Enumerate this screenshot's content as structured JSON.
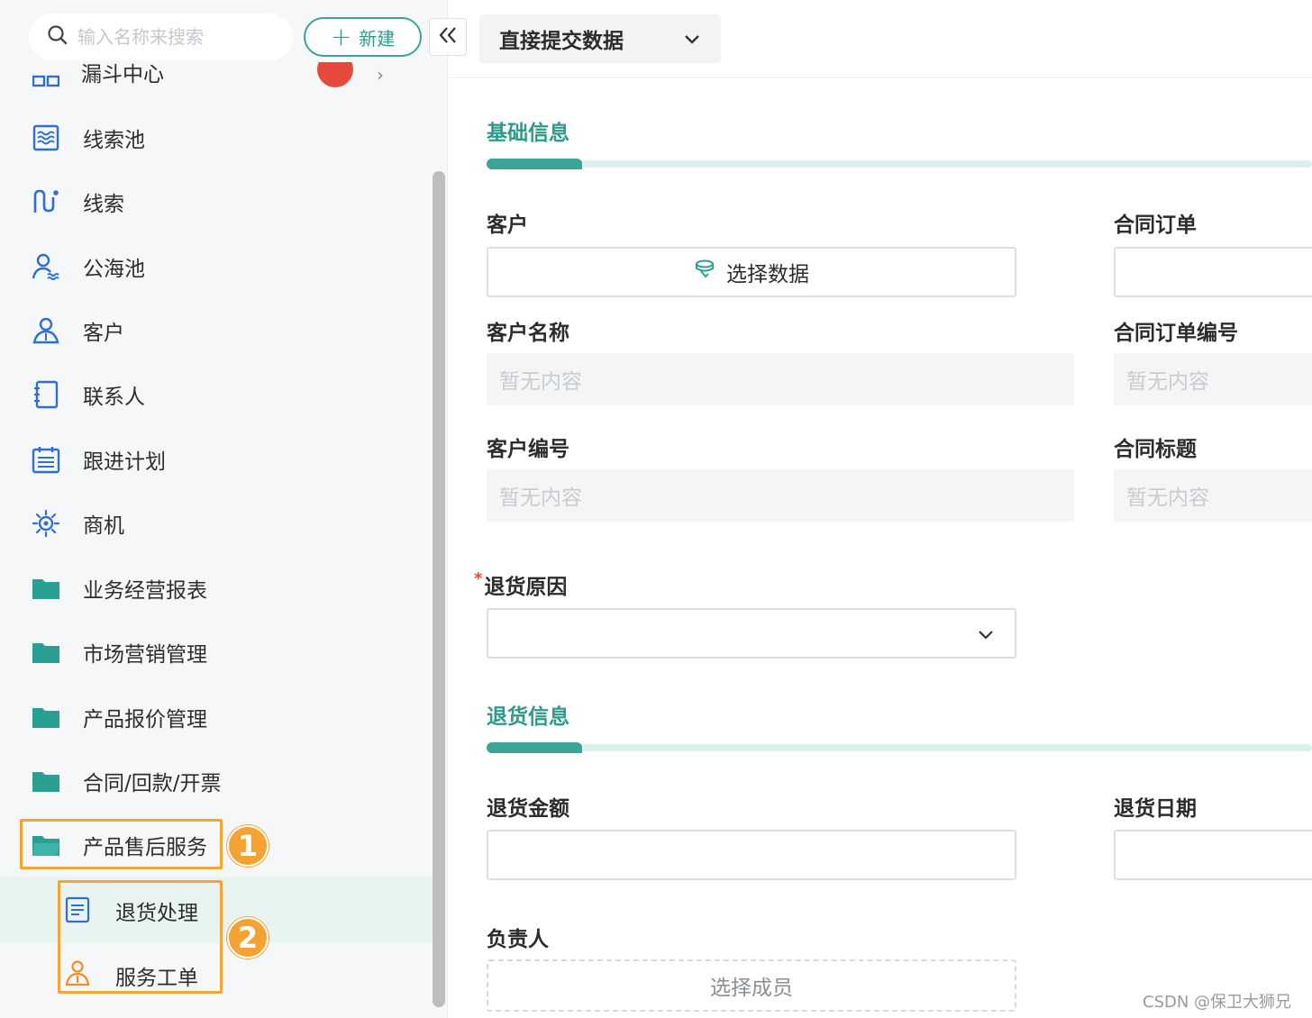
{
  "search": {
    "placeholder": "输入名称来搜索"
  },
  "new_button": {
    "label": "新建"
  },
  "sidebar": {
    "partial_label": "漏斗中心",
    "items": [
      {
        "label": "线索池",
        "icon": "lead-pool-icon"
      },
      {
        "label": "线索",
        "icon": "lead-icon"
      },
      {
        "label": "公海池",
        "icon": "public-pool-icon"
      },
      {
        "label": "客户",
        "icon": "customer-icon"
      },
      {
        "label": "联系人",
        "icon": "contact-icon"
      },
      {
        "label": "跟进计划",
        "icon": "plan-icon"
      },
      {
        "label": "商机",
        "icon": "opportunity-icon"
      },
      {
        "label": "业务经营报表",
        "icon": "folder-icon"
      },
      {
        "label": "市场营销管理",
        "icon": "folder-icon"
      },
      {
        "label": "产品报价管理",
        "icon": "folder-icon"
      },
      {
        "label": "合同/回款/开票",
        "icon": "folder-icon"
      },
      {
        "label": "产品售后服务",
        "icon": "folder-open-icon"
      }
    ],
    "sub_items": [
      {
        "label": "退货处理",
        "icon": "document-icon"
      },
      {
        "label": "服务工单",
        "icon": "person-icon"
      }
    ],
    "annotations": [
      "1",
      "2"
    ]
  },
  "header": {
    "mode_label": "直接提交数据"
  },
  "form": {
    "section_basic": "基础信息",
    "customer_label": "客户",
    "select_data_label": "选择数据",
    "contract_order_label": "合同订单",
    "customer_name_label": "客户名称",
    "contract_order_no_label": "合同订单编号",
    "customer_no_label": "客户编号",
    "contract_title_label": "合同标题",
    "empty_text": "暂无内容",
    "return_reason_label": "退货原因",
    "required_mark": "*",
    "section_return": "退货信息",
    "return_amount_label": "退货金额",
    "return_date_label": "退货日期",
    "owner_label": "负责人",
    "select_member_label": "选择成员"
  },
  "watermark": "CSDN @保卫大狮兄",
  "colors": {
    "accent": "#3aa596",
    "highlight": "#f4a537",
    "required": "#e64a3c"
  }
}
